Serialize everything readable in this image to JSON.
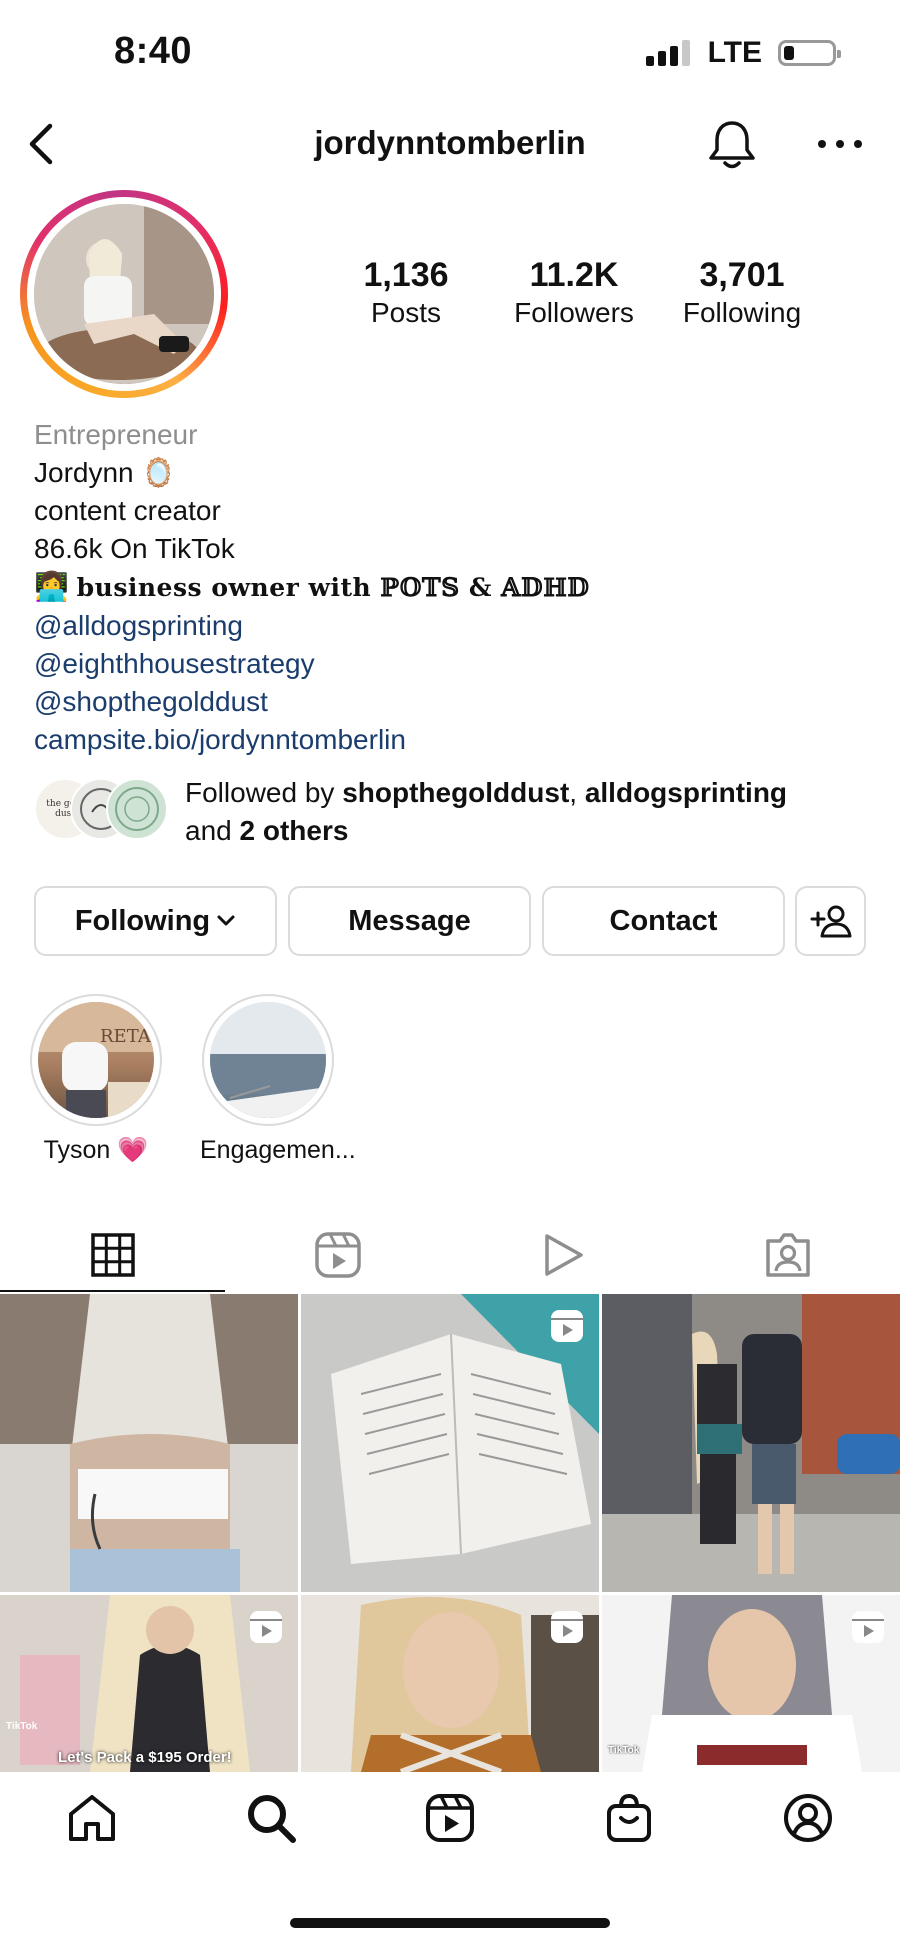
{
  "status_bar": {
    "time": "8:40",
    "network": "LTE"
  },
  "header": {
    "username": "jordynntomberlin"
  },
  "stats": [
    {
      "value": "1,136",
      "label": "Posts"
    },
    {
      "value": "11.2K",
      "label": "Followers"
    },
    {
      "value": "3,701",
      "label": "Following"
    }
  ],
  "bio": {
    "category": "Entrepreneur",
    "name": "Jordynn",
    "name_emoji": "🪞",
    "line1": "content creator",
    "line2": "86.6k On TikTok",
    "line3_emoji": "👩‍💻",
    "line3": "𝐛𝐮𝐬𝐢𝐧𝐞𝐬𝐬 𝐨𝐰𝐧𝐞𝐫 𝐰𝐢𝐭𝐡 ℙ𝕆𝕋𝕊 & 𝔸𝔻ℍ𝔻",
    "mentions": [
      "@alldogsprinting",
      "@eighthhousestrategy",
      "@shopthegolddust"
    ],
    "link": "campsite.bio/jordynntomberlin"
  },
  "followed_by": {
    "prefix": "Followed by ",
    "user1": "shopthegolddust",
    "sep": ", ",
    "user2": "alldogsprinting",
    "and": "and ",
    "others": "2 others",
    "avatar1_text": "the gold dust"
  },
  "actions": {
    "following": "Following",
    "message": "Message",
    "contact": "Contact"
  },
  "highlights": [
    {
      "label": "Tyson 💗"
    },
    {
      "label": "Engagemen..."
    }
  ],
  "grid": {
    "overlay_text": "Let's Pack a $195 Order!",
    "tiktok_label": "TikTok"
  },
  "colors": {
    "link": "#1b3d6d",
    "border": "#dbdbdb",
    "muted": "#8e8e8e"
  }
}
